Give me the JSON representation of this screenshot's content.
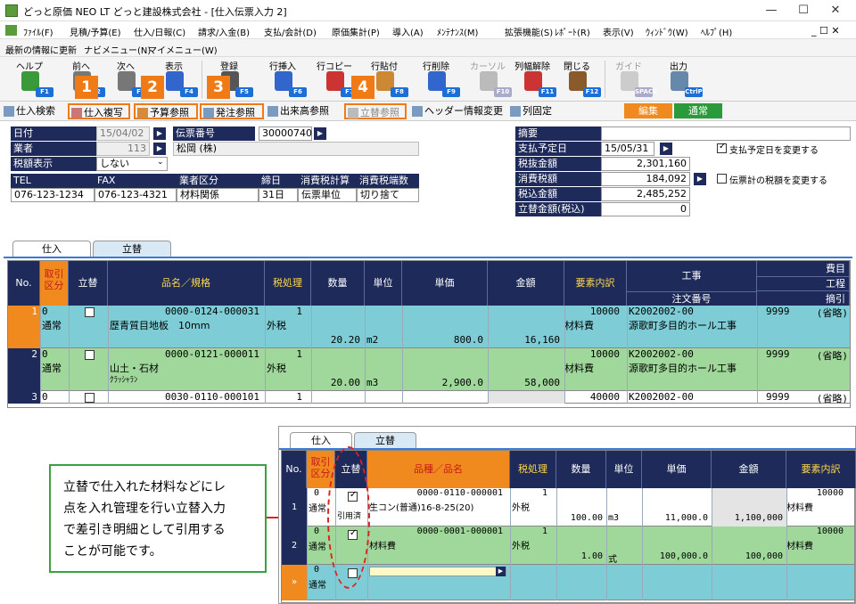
{
  "window": {
    "title": "どっと原価 NEO LT どっと建設株式会社 - [仕入伝票入力 2]",
    "btn_min": "—",
    "btn_max": "☐",
    "btn_close": "✕"
  },
  "menubar": {
    "items": [
      "ﾌｧｲﾙ(F)",
      "見積/予算(E)",
      "仕入/日報(C)",
      "請求/入金(B)",
      "支払/会計(D)",
      "原価集計(P)",
      "導入(A)",
      "ﾒﾝﾃﾅﾝｽ(M)",
      "拡張機能(S)",
      "ﾚﾎﾟｰﾄ(R)",
      "表示(V)",
      "ｳｨﾝﾄﾞｳ(W)",
      "ﾍﾙﾌﾟ(H)"
    ],
    "right": "_ ☐ ✕"
  },
  "linkbar": {
    "items": [
      "最新の情報に更新",
      "ナビメニュー(N)",
      "マイメニュー(W)"
    ]
  },
  "toolbar": {
    "items": [
      {
        "label": "ヘルプ",
        "key": "F1",
        "icon": "help-icon",
        "color": "#3a9a3a"
      },
      {
        "label": "前へ",
        "key": "F2",
        "icon": "prev-icon",
        "color": "#777"
      },
      {
        "label": "次へ",
        "key": "F3",
        "icon": "next-icon",
        "color": "#777"
      },
      {
        "label": "表示",
        "key": "F4",
        "icon": "view-icon",
        "color": "#3366cc"
      },
      {
        "label": "登録",
        "key": "F5",
        "icon": "save-icon",
        "color": "#555"
      },
      {
        "label": "行挿入",
        "key": "F6",
        "icon": "insert-row-icon",
        "color": "#3366cc"
      },
      {
        "label": "行コピー",
        "key": "F7",
        "icon": "copy-row-icon",
        "color": "#cc3333"
      },
      {
        "label": "行貼付",
        "key": "F8",
        "icon": "paste-row-icon",
        "color": "#cc8833"
      },
      {
        "label": "行削除",
        "key": "F9",
        "icon": "delete-row-icon",
        "color": "#3366cc"
      },
      {
        "label": "カーソル",
        "key": "F10",
        "icon": "cursor-icon",
        "color": "#bbb"
      },
      {
        "label": "列幅解除",
        "key": "F11",
        "icon": "column-width-icon",
        "color": "#cc3333"
      },
      {
        "label": "閉じる",
        "key": "F12",
        "icon": "close-door-icon",
        "color": "#8a5a2a"
      },
      {
        "label": "ガイド",
        "key": "SPACE",
        "icon": "guide-bulb-icon",
        "color": "#ccc"
      },
      {
        "label": "出力",
        "key": "CtrlP",
        "icon": "print-icon",
        "color": "#6688aa"
      }
    ]
  },
  "buttons": {
    "search": "仕入検索",
    "copy": "仕入複写",
    "budget_ref": "予算参照",
    "order_ref": "発注参照",
    "progress_ref": "出来高参照",
    "advance_ref": "立替参照",
    "header_change": "ヘッダー情報変更",
    "fix_columns": "列固定",
    "mode_edit": "編集",
    "mode_normal": "通常"
  },
  "badges": [
    "1",
    "2",
    "3",
    "4"
  ],
  "form": {
    "date_label": "日付",
    "date_value": "15/04/02",
    "vendor_label": "業者",
    "vendor_code": "113",
    "tax_display_label": "税額表示",
    "tax_display_value": "しない",
    "slip_no_label": "伝票番号",
    "slip_no_value": "30000740",
    "vendor_name": "松岡 (株)",
    "tel_label": "TEL",
    "tel_value": "076-123-1234",
    "fax_label": "FAX",
    "fax_value": "076-123-4321",
    "category_label": "業者区分",
    "category_value": "材料関係",
    "closing_label": "締日",
    "closing_value": "31日",
    "tax_calc_label": "消費税計算",
    "tax_calc_value": "伝票単位",
    "rounding_label": "消費税端数",
    "rounding_value": "切り捨て",
    "memo_label": "摘要",
    "memo_value": "",
    "paydate_label": "支払予定日",
    "paydate_value": "15/05/31",
    "paydate_change": "支払予定日を変更する",
    "net_label": "税抜金額",
    "net_value": "2,301,160",
    "tax_label": "消費税額",
    "tax_value": "184,092",
    "tax_change": "伝票計の税額を変更する",
    "gross_label": "税込金額",
    "gross_value": "2,485,252",
    "advance_label": "立替金額(税込)",
    "advance_value": "0"
  },
  "tabs": {
    "purchase": "仕入",
    "advance": "立替"
  },
  "grid": {
    "headers": {
      "no": "No.",
      "kubun": "取引\n区分",
      "tatekae": "立替",
      "item": "品名／規格",
      "tax": "税処理",
      "qty": "数量",
      "unit": "単位",
      "price": "単価",
      "amount": "金額",
      "element": "要素内訳",
      "koji": "工事",
      "order": "注文番号",
      "himoku": "費目",
      "kotei": "工程",
      "tekibiki": "摘引"
    },
    "rows": [
      {
        "no": "1",
        "code": "0",
        "kubun": "通常",
        "item_code": "0000-0124-000031",
        "item_name": "歴青質目地板　10mm",
        "sub": "",
        "tax_code": "1",
        "tax": "外税",
        "qty": "20.20",
        "unit": "m2",
        "price": "800.0",
        "amount": "16,160",
        "el_code": "10000",
        "el_name": "材料費",
        "koji_code": "K2002002-00",
        "koji_name": "源歌町多目的ホール工事",
        "himoku": "9999",
        "omit": "(省略)"
      },
      {
        "no": "2",
        "code": "0",
        "kubun": "通常",
        "item_code": "0000-0121-000011",
        "item_name": "山土・石材",
        "sub": "ｸﾗｯｼｬﾗﾝ",
        "tax_code": "1",
        "tax": "外税",
        "qty": "20.00",
        "unit": "m3",
        "price": "2,900.0",
        "amount": "58,000",
        "el_code": "10000",
        "el_name": "材料費",
        "koji_code": "K2002002-00",
        "koji_name": "源歌町多目的ホール工事",
        "himoku": "9999",
        "omit": "(省略)"
      },
      {
        "no": "3",
        "code": "0",
        "kubun": "",
        "item_code": "0030-0110-000101",
        "item_name": "",
        "sub": "",
        "tax_code": "1",
        "tax": "",
        "qty": "",
        "unit": "",
        "price": "",
        "amount": "",
        "el_code": "40000",
        "el_name": "",
        "koji_code": "K2002002-00",
        "koji_name": "",
        "himoku": "9999",
        "omit": "(省略)"
      }
    ]
  },
  "note": {
    "text": "立替で仕入れた材料などにレ点を入れ管理を行い立替入力で差引き明細として引用することが可能です。",
    "lines": [
      "立替で仕入れた材料などにレ",
      "点を入れ管理を行い立替入力",
      "で差引き明細として引用する",
      "ことが可能です。"
    ]
  },
  "inset": {
    "tabs": {
      "purchase": "仕入",
      "advance": "立替"
    },
    "headers": {
      "no": "No.",
      "kubun": "取引\n区分",
      "tatekae": "立替",
      "item": "品種／品名",
      "tax": "税処理",
      "qty": "数量",
      "unit": "単位",
      "price": "単価",
      "amount": "金額",
      "element": "要素内訳"
    },
    "rows": [
      {
        "no": "1",
        "code": "0",
        "kubun": "通常",
        "quoted": "引用済",
        "item_code": "0000-0110-000001",
        "item_name": "生コン(普通)16-8-25(20)",
        "tax_code": "1",
        "tax": "外税",
        "qty": "100.00",
        "unit": "m3",
        "price": "11,000.0",
        "amount": "1,100,000",
        "el_code": "10000",
        "el_name": "材料費",
        "checked": true
      },
      {
        "no": "2",
        "code": "0",
        "kubun": "通常",
        "quoted": "",
        "item_code": "0000-0001-000001",
        "item_name": "材料費",
        "tax_code": "1",
        "tax": "外税",
        "qty": "1.00",
        "unit": "式",
        "price": "100,000.0",
        "amount": "100,000",
        "el_code": "10000",
        "el_name": "材料費",
        "checked": true
      },
      {
        "no": "»",
        "code": "0",
        "kubun": "通常",
        "quoted": "",
        "item_code": "",
        "item_name": "",
        "tax_code": "",
        "tax": "",
        "qty": "",
        "unit": "",
        "price": "",
        "amount": "",
        "el_code": "",
        "el_name": "",
        "checked": false
      }
    ]
  }
}
